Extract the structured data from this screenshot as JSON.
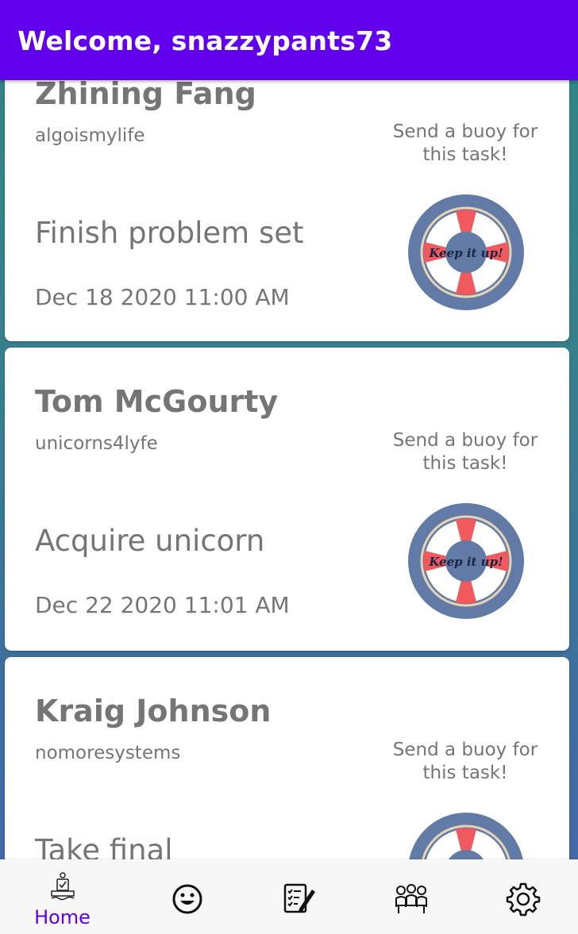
{
  "header": {
    "title": "Welcome, snazzypants73"
  },
  "buoy_prompt": "Send a buoy for this task!",
  "buoy_label": "Keep it up!",
  "cards": [
    {
      "name": "Zhining Fang",
      "handle": "algoismylife",
      "task": "Finish problem set",
      "date": "Dec 18 2020 11:00 AM"
    },
    {
      "name": "Tom McGourty",
      "handle": "unicorns4lyfe",
      "task": "Acquire unicorn",
      "date": "Dec 22 2020 11:01 AM"
    },
    {
      "name": "Kraig Johnson",
      "handle": "nomoresystems",
      "task": "Take final",
      "date": ""
    }
  ],
  "nav": {
    "items": [
      {
        "icon": "home-icon",
        "label": "Home",
        "active": true
      },
      {
        "icon": "smiley-icon",
        "label": ""
      },
      {
        "icon": "checklist-icon",
        "label": ""
      },
      {
        "icon": "group-icon",
        "label": ""
      },
      {
        "icon": "gear-icon",
        "label": ""
      }
    ]
  },
  "colors": {
    "accent": "#6200ee",
    "buoy_blue": "#627aa6",
    "buoy_red": "#f05a5e",
    "text_gray": "#757575"
  }
}
